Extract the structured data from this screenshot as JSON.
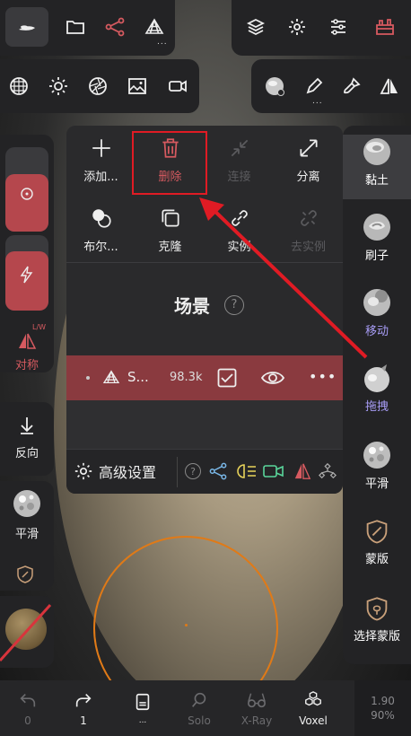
{
  "toolbar": {
    "top_left_sub": "...",
    "top_right_sub": "...",
    "top_right2_sub": "..."
  },
  "popup": {
    "add_label": "添加...",
    "delete_label": "删除",
    "connect_label": "连接",
    "separate_label": "分离",
    "boolean_label": "布尔...",
    "clone_label": "克隆",
    "instance_label": "实例",
    "deinstance_label": "去实例",
    "scene_title": "场景",
    "scene_item": {
      "name": "S...",
      "count": "98.3k"
    },
    "advanced_label": "高级设置"
  },
  "right_tools": [
    {
      "label": "黏土",
      "color": "#ffffff"
    },
    {
      "label": "刷子",
      "color": "#ffffff"
    },
    {
      "label": "移动",
      "color": "#a79cf5"
    },
    {
      "label": "拖拽",
      "color": "#a79cf5"
    },
    {
      "label": "平滑",
      "color": "#ffffff"
    },
    {
      "label": "蒙版",
      "color": "#ffffff"
    },
    {
      "label": "选择蒙版",
      "color": "#ffffff"
    }
  ],
  "left_tools": {
    "lw_label": "L/W",
    "symmetry_label": "对称",
    "reverse_label": "反向",
    "smooth_label": "平滑"
  },
  "bottom": {
    "undo_count": "0",
    "redo_count": "1",
    "doc_sub": "...",
    "solo_label": "Solo",
    "xray_label": "X-Ray",
    "voxel_label": "Voxel",
    "zoom_value": "1.90",
    "opacity_value": "90%"
  },
  "colors": {
    "accent_red": "#b5474d",
    "highlight_box": "#e01b24",
    "arrow": "#e01b24",
    "purple_label": "#a79cf5"
  }
}
